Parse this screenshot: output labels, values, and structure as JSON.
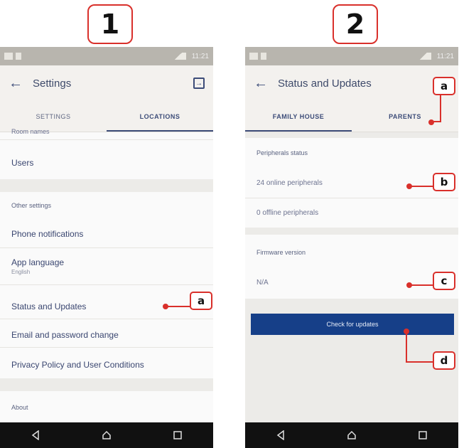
{
  "steps": [
    "1",
    "2"
  ],
  "screen1": {
    "title": "Settings",
    "tabs": [
      "SETTINGS",
      "LOCATIONS"
    ],
    "items": {
      "partial": "Room names",
      "users": "Users",
      "other_settings": "Other settings",
      "phone_notifications": "Phone notifications",
      "app_language": "App language",
      "app_language_value": "English",
      "status_updates": "Status and Updates",
      "email_password": "Email and password change",
      "privacy": "Privacy Policy and User Conditions",
      "about": "About"
    },
    "callouts": [
      "a"
    ]
  },
  "screen2": {
    "title": "Status and Updates",
    "tabs": [
      "FAMILY HOUSE",
      "PARENTS"
    ],
    "peripherals_header": "Peripherals status",
    "online": "24 online peripherals",
    "offline": "0 offline peripherals",
    "firmware_header": "Firmware version",
    "firmware_value": "N/A",
    "check_button": "Check for updates",
    "callouts": [
      "a",
      "b",
      "c",
      "d"
    ]
  },
  "status_bar": {
    "time": "11:21"
  },
  "colors": {
    "accent": "#163f88",
    "callout": "#d9302b"
  }
}
